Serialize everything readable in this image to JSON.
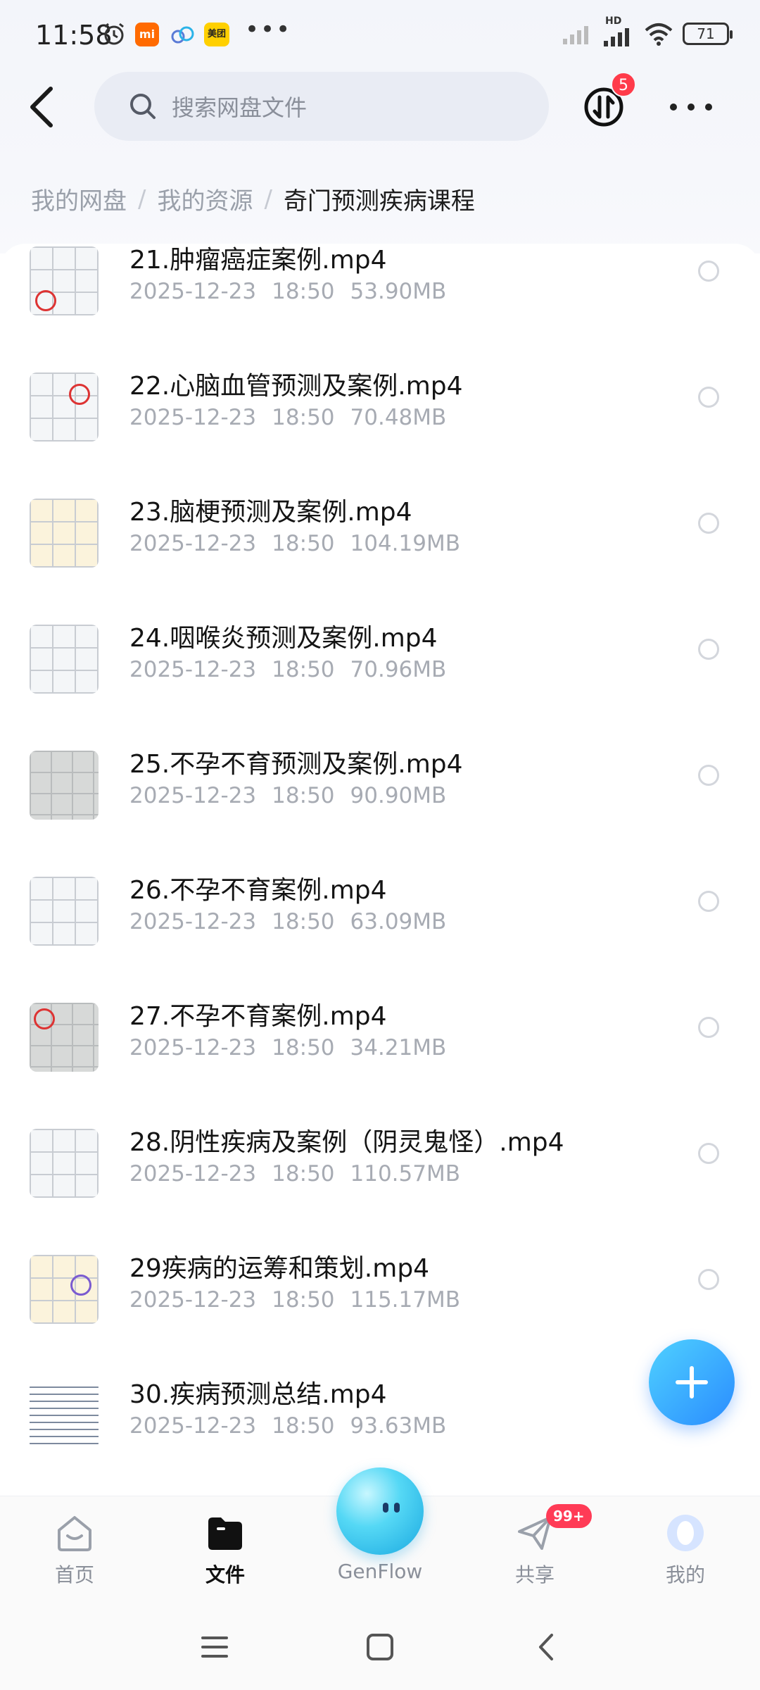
{
  "status_bar": {
    "time": "11:58",
    "battery": "71",
    "network_label": "HD",
    "app_icons": [
      "alarm-icon",
      "mi-icon",
      "cloud-icon",
      "meituan-icon"
    ],
    "meituan_label": "美团",
    "mi_label": "mi",
    "overflow": "•••"
  },
  "header": {
    "search_placeholder": "搜索网盘文件",
    "transfer_badge": "5"
  },
  "breadcrumb": {
    "items": [
      "我的网盘",
      "我的资源",
      "奇门预测疾病课程"
    ]
  },
  "files": [
    {
      "name": "21.肿瘤癌症案例.mp4",
      "date": "2025-12-23",
      "time": "18:50",
      "size": "53.90MB"
    },
    {
      "name": "22.心脑血管预测及案例.mp4",
      "date": "2025-12-23",
      "time": "18:50",
      "size": "70.48MB"
    },
    {
      "name": "23.脑梗预测及案例.mp4",
      "date": "2025-12-23",
      "time": "18:50",
      "size": "104.19MB"
    },
    {
      "name": "24.咽喉炎预测及案例.mp4",
      "date": "2025-12-23",
      "time": "18:50",
      "size": "70.96MB"
    },
    {
      "name": "25.不孕不育预测及案例.mp4",
      "date": "2025-12-23",
      "time": "18:50",
      "size": "90.90MB"
    },
    {
      "name": "26.不孕不育案例.mp4",
      "date": "2025-12-23",
      "time": "18:50",
      "size": "63.09MB"
    },
    {
      "name": "27.不孕不育案例.mp4",
      "date": "2025-12-23",
      "time": "18:50",
      "size": "34.21MB"
    },
    {
      "name": "28.阴性疾病及案例（阴灵鬼怪）.mp4",
      "date": "2025-12-23",
      "time": "18:50",
      "size": "110.57MB"
    },
    {
      "name": "29疾病的运筹和策划.mp4",
      "date": "2025-12-23",
      "time": "18:50",
      "size": "115.17MB"
    },
    {
      "name": "30.疾病预测总结.mp4",
      "date": "2025-12-23",
      "time": "18:50",
      "size": "93.63MB"
    }
  ],
  "bottom_nav": {
    "home": "首页",
    "files": "文件",
    "genflow": "GenFlow",
    "share": "共享",
    "share_badge": "99+",
    "me": "我的"
  },
  "colors": {
    "accent": "#2a8cff",
    "badge": "#ff3b4a",
    "meta_text": "#a7abb3"
  }
}
